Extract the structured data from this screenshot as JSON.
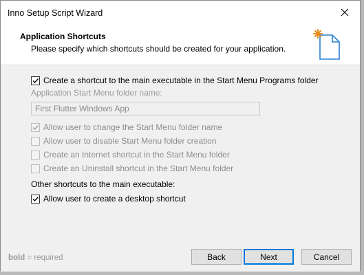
{
  "window": {
    "title": "Inno Setup Script Wizard",
    "close_icon": "close-icon"
  },
  "header": {
    "title": "Application Shortcuts",
    "subtitle": "Please specify which shortcuts should be created for your application.",
    "icon": "wizard-document-icon"
  },
  "options": {
    "start_menu_shortcut": {
      "label": "Create a shortcut to the main executable in the Start Menu Programs folder",
      "checked": true,
      "enabled": true
    },
    "folder_name_label": "Application Start Menu folder name:",
    "folder_name_value": "First Flutter Windows App",
    "allow_change_folder": {
      "label": "Allow user to change the Start Menu folder name",
      "checked": true,
      "enabled": false
    },
    "allow_disable_folder": {
      "label": "Allow user to disable Start Menu folder creation",
      "checked": false,
      "enabled": false
    },
    "internet_shortcut": {
      "label": "Create an Internet shortcut in the Start Menu folder",
      "checked": false,
      "enabled": false
    },
    "uninstall_shortcut": {
      "label": "Create an Uninstall shortcut in the Start Menu folder",
      "checked": false,
      "enabled": false
    },
    "other_shortcuts_label": "Other shortcuts to the main executable:",
    "desktop_shortcut": {
      "label": "Allow user to create a desktop shortcut",
      "checked": true,
      "enabled": true
    }
  },
  "footer": {
    "hint_bold": "bold",
    "hint_rest": " = required",
    "back": "Back",
    "next": "Next",
    "cancel": "Cancel"
  },
  "colors": {
    "accent": "#0078d7",
    "disabled_text": "#8d8d8d",
    "panel": "#f0f0f0"
  }
}
